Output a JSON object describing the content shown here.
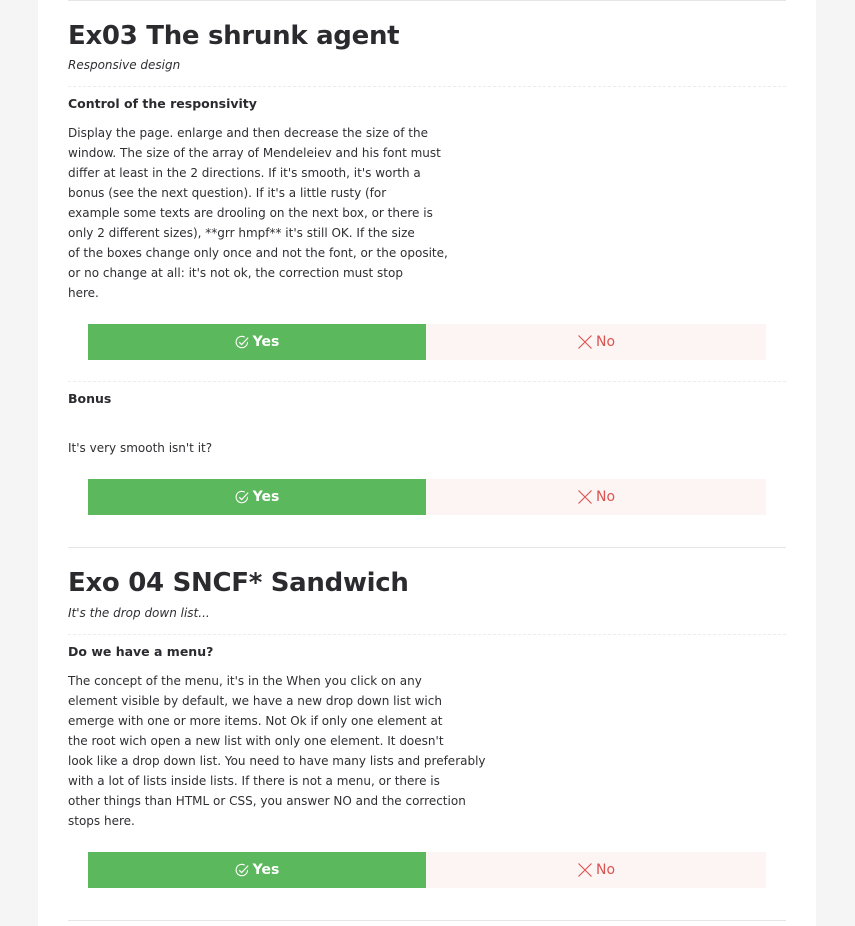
{
  "exercises": [
    {
      "title": "Ex03 The shrunk agent",
      "subtitle": "Responsive design",
      "questions": [
        {
          "title": "Control of the responsivity",
          "lines": [
            "Display the page. enlarge and then decrease the size of the",
            "window. The size of the array of Mendeleiev and his font must",
            "differ at least in the 2 directions. If it's smooth, it's worth a",
            "bonus (see the next question). If it's a little rusty (for",
            "example some texts are drooling on the next box, or there is",
            "only 2 different sizes), **grr hmpf** it's still OK. If the size",
            "of the boxes change only once and not the font, or the oposite,",
            "or no change at all: it's not ok, the correction must stop",
            "here."
          ],
          "yes_label": "Yes",
          "no_label": "No"
        },
        {
          "title": "Bonus",
          "lines": [
            "It's very smooth isn't it?"
          ],
          "yes_label": "Yes",
          "no_label": "No"
        }
      ]
    },
    {
      "title": "Exo 04 SNCF* Sandwich",
      "subtitle": "It's the drop down list...",
      "questions": [
        {
          "title": "Do we have a menu?",
          "lines": [
            "The concept of the menu, it's in the When you click on any",
            "element visible by default, we have a new drop down list wich",
            "emerge with one or more items. Not Ok if only one element at",
            "the root wich open a new list with only one element. It doesn't",
            "look like a drop down list. You need to have many lists and preferably",
            "with a lot of lists inside lists. If there is not a menu, or there is",
            "other things than HTML or CSS, you answer NO and the correction",
            "stops here."
          ],
          "yes_label": "Yes",
          "no_label": "No"
        }
      ]
    }
  ],
  "icons": {
    "yes": "check-circle-icon",
    "no": "x-cross-icon"
  },
  "colors": {
    "yes_bg": "#5cb85c",
    "no_bg": "#fdf4f4",
    "no_text": "#d9534f"
  }
}
